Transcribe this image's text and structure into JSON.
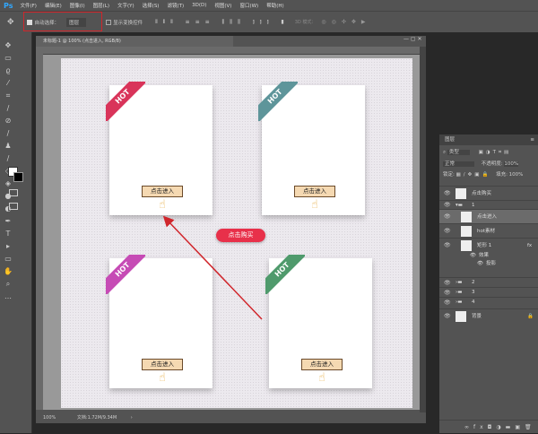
{
  "app": {
    "logo": "Ps"
  },
  "menu": [
    "文件(F)",
    "编辑(E)",
    "图像(I)",
    "图层(L)",
    "文字(Y)",
    "选择(S)",
    "滤镜(T)",
    "3D(D)",
    "视图(V)",
    "窗口(W)",
    "帮助(H)"
  ],
  "options": {
    "auto_select_label": "自动选择：",
    "auto_select_checked": true,
    "auto_select_value": "图层",
    "show_transform": "显示变换控件",
    "mode_3d": "3D 模式："
  },
  "document": {
    "tab": "未标题-1 @ 100% (点击进入, RGB/8)",
    "zoom": "100%",
    "doc_info": "文档:1.72M/9.34M"
  },
  "canvas": {
    "cards": [
      {
        "badge": "HOT",
        "color": "#d9345a",
        "button": "点击进入"
      },
      {
        "badge": "HOT",
        "color": "#5e959a",
        "button": "点击进入"
      },
      {
        "badge": "HOT",
        "color": "#c64bb5",
        "button": "点击进入"
      },
      {
        "badge": "HOT",
        "color": "#4f9a6c",
        "button": "点击进入"
      }
    ],
    "buy_button": "点击购买",
    "arrow_color": "#d0262c"
  },
  "layers_panel": {
    "title": "图层",
    "filter": "类型",
    "blend_mode": "正常",
    "opacity_label": "不透明度:",
    "opacity": "100%",
    "lock_label": "锁定:",
    "fill_label": "填充:",
    "fill": "100%",
    "layers": [
      {
        "name": "点击购买",
        "type": "smart"
      },
      {
        "name": "1",
        "type": "group"
      },
      {
        "name": "点击进入",
        "type": "smart",
        "selected": true
      },
      {
        "name": "hot素材",
        "type": "smart"
      },
      {
        "name": "矩形 1",
        "type": "smart",
        "fx": "fx"
      },
      {
        "name": "效果",
        "type": "effect"
      },
      {
        "name": "投影",
        "type": "effect"
      },
      {
        "name": "2",
        "type": "group"
      },
      {
        "name": "3",
        "type": "group"
      },
      {
        "name": "4",
        "type": "group"
      },
      {
        "name": "背景",
        "type": "background"
      }
    ],
    "footer_fx": "fx"
  }
}
